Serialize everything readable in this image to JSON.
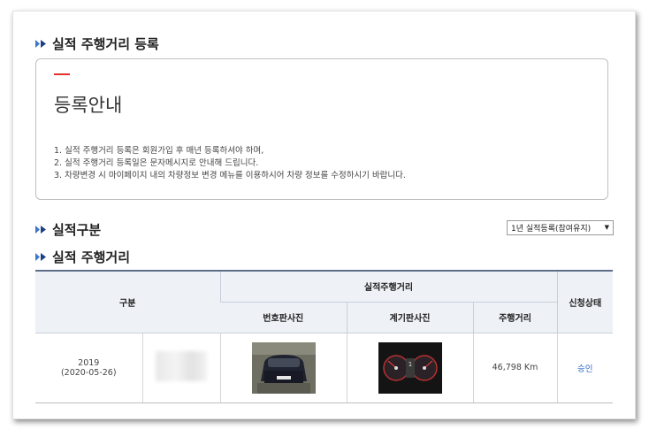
{
  "sections": {
    "register_title": "실적 주행거리 등록",
    "category_title": "실적구분",
    "mileage_title": "실적 주행거리"
  },
  "notice": {
    "heading": "등록안내",
    "lines": [
      "1. 실적 주행거리 등록은 회원가입 후 매년 등록하셔야 하며,",
      "2. 실적 주행거리 등록일은 문자메시지로 안내해 드립니다.",
      "3. 차량변경 시 마이페이지 내의 차량정보 변경 메뉴를 이용하시어 차량 정보를 수정하시기 바랍니다."
    ]
  },
  "select": {
    "value": "1년 실적등록(참여유지)"
  },
  "table": {
    "headers": {
      "category": "구분",
      "group": "실적주행거리",
      "plate_photo": "번호판사진",
      "dash_photo": "계기판사진",
      "distance": "주행거리",
      "status": "신청상태"
    },
    "rows": [
      {
        "year": "2019",
        "date": "(2020-05-26)",
        "distance": "46,798 Km",
        "status": "승인"
      }
    ]
  },
  "colors": {
    "accent_blue": "#2b66c9",
    "notice_red": "#e4312f",
    "header_line": "#5d6e86"
  }
}
